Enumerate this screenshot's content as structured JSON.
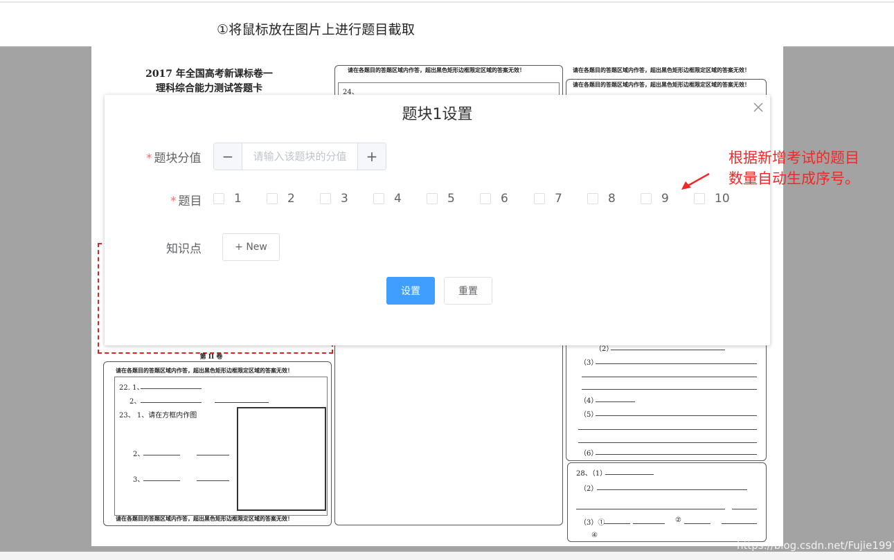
{
  "instruction": "①将鼠标放在图片上进行题目截取",
  "sheet": {
    "title_line1": "2017 年全国高考新课标卷一",
    "title_line2": "理科综合能力测试答题卡",
    "notice": "请在各题目的答题区域内作答，超出黑色矩形边框限定区域的答案无效！",
    "q24": "24、",
    "section_label": "第 II 卷",
    "q22_1": "22. 1、",
    "q22_2": "2、",
    "q23_1": "23、 1、请在方框内作图",
    "q23_2": "2、",
    "q23_3": "3、",
    "r_2": "（2）",
    "r_3": "（3）",
    "r_4": "（4）",
    "r_5": "（5）",
    "r_6": "（6）",
    "q28_1": "28、（1）",
    "q28_2": "（2）",
    "q28_3": "（3）①",
    "q28_3b": "②",
    "q28_4": "④"
  },
  "dialog": {
    "title": "题块1设置",
    "score_label": "题块分值",
    "score_placeholder": "请输入该题块的分值",
    "score_minus": "−",
    "score_plus": "+",
    "questions_label": "题目",
    "questions": [
      "1",
      "2",
      "3",
      "4",
      "5",
      "6",
      "7",
      "8",
      "9",
      "10"
    ],
    "knowledge_label": "知识点",
    "new_button": "+ New",
    "submit_button": "设置",
    "reset_button": "重置"
  },
  "annotation": {
    "line1": "根据新增考试的题目",
    "line2": "数量自动生成序号。"
  },
  "watermark": "https://blog.csdn.net/Fujie1997",
  "colors": {
    "primary": "#409eff",
    "required": "#f56c6c",
    "annotation": "#f02828",
    "overlay_gray": "#a3a3a3"
  }
}
